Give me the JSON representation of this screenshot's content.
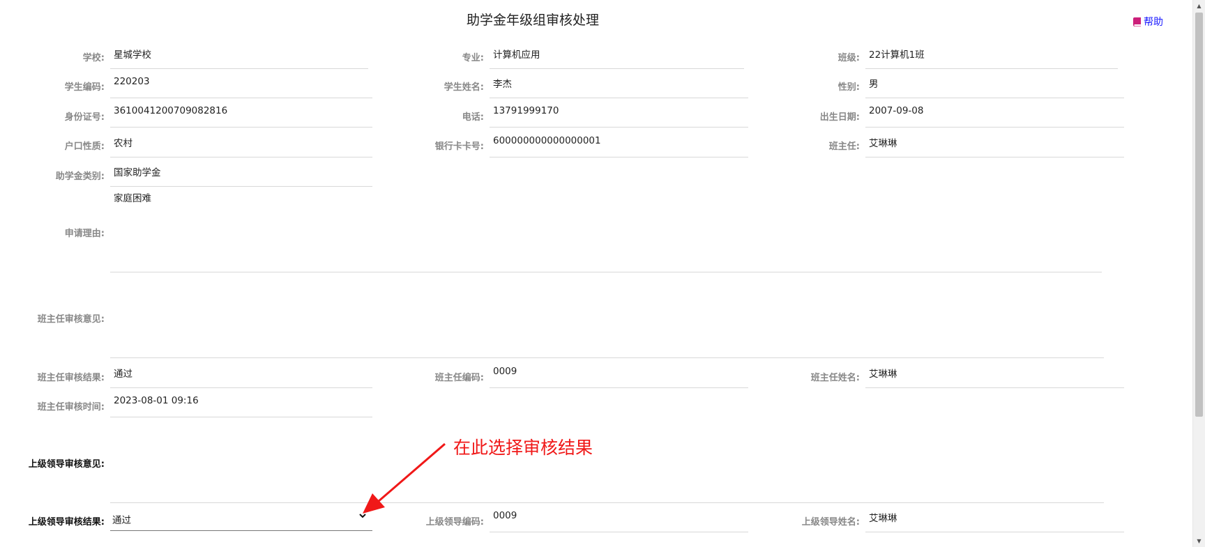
{
  "page": {
    "title": "助学金年级组审核处理",
    "help_label": "帮助"
  },
  "colors": {
    "accent_link": "#1a1aff",
    "annotation": "#f01818",
    "help_icon": "#cc1f7a"
  },
  "fields": {
    "school": {
      "label": "学校:",
      "value": "星城学校"
    },
    "major": {
      "label": "专业:",
      "value": "计算机应用"
    },
    "class": {
      "label": "班级:",
      "value": "22计算机1班"
    },
    "student_code": {
      "label": "学生编码:",
      "value": "220203"
    },
    "student_name": {
      "label": "学生姓名:",
      "value": "李杰"
    },
    "gender": {
      "label": "性别:",
      "value": "男"
    },
    "id_number": {
      "label": "身份证号:",
      "value": "3610041200709082816"
    },
    "phone": {
      "label": "电话:",
      "value": "13791999170"
    },
    "birth_date": {
      "label": "出生日期:",
      "value": "2007-09-08"
    },
    "household": {
      "label": "户口性质:",
      "value": "农村"
    },
    "bank_card": {
      "label": "银行卡卡号:",
      "value": "600000000000000001"
    },
    "head_teacher": {
      "label": "班主任:",
      "value": "艾琳琳"
    },
    "grant_type": {
      "label": "助学金类别:",
      "value": "国家助学金"
    },
    "apply_reason": {
      "label": "申请理由:",
      "value": "家庭困难"
    },
    "teacher_opinion": {
      "label": "班主任审核意见:",
      "value": ""
    },
    "teacher_result": {
      "label": "班主任审核结果:",
      "value": "通过"
    },
    "teacher_code": {
      "label": "班主任编码:",
      "value": "0009"
    },
    "teacher_name": {
      "label": "班主任姓名:",
      "value": "艾琳琳"
    },
    "teacher_time": {
      "label": "班主任审核时间:",
      "value": "2023-08-01 09:16"
    },
    "leader_opinion": {
      "label": "上级领导审核意见:",
      "value": ""
    },
    "leader_result": {
      "label": "上级领导审核结果:",
      "value": "通过"
    },
    "leader_code": {
      "label": "上级领导编码:",
      "value": "0009"
    },
    "leader_name": {
      "label": "上级领导姓名:",
      "value": "艾琳琳"
    }
  },
  "annotation": {
    "text": "在此选择审核结果"
  }
}
